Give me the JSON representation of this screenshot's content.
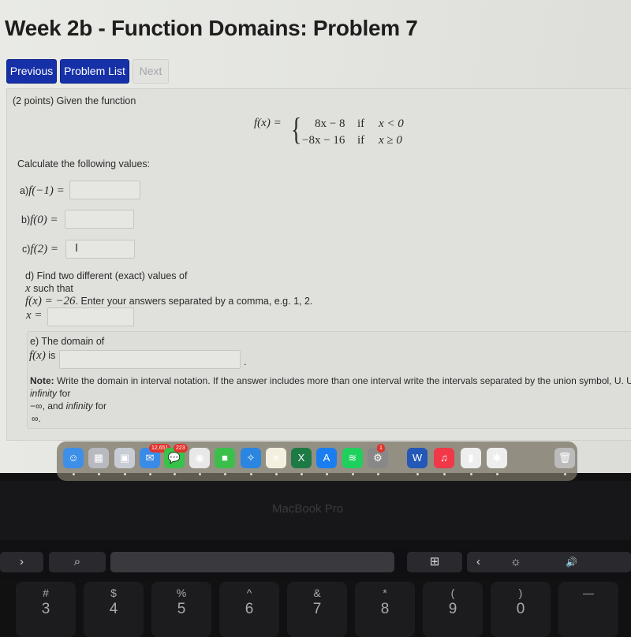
{
  "page": {
    "title": "Week 2b - Function Domains: Problem 7",
    "nav": {
      "previous": "Previous",
      "problem_list": "Problem List",
      "next": "Next"
    }
  },
  "problem": {
    "intro": "(2 points) Given the function",
    "function_lhs": "f(x) =",
    "cases": [
      {
        "expr": "8x − 8",
        "cond_word": "if",
        "cond": "x < 0"
      },
      {
        "expr": "−8x − 16",
        "cond_word": "if",
        "cond": "x ≥ 0"
      }
    ],
    "calc_prompt": "Calculate the following values:",
    "parts": {
      "a": {
        "prefix": "a)",
        "label": "f(−1) =",
        "value": ""
      },
      "b": {
        "prefix": "b)",
        "label": "f(0) =",
        "value": ""
      },
      "c": {
        "prefix": "c)",
        "label": "f(2) =",
        "value": ""
      },
      "d": {
        "line1": "d) Find two different (exact) values of",
        "line2_var": "x",
        "line2": " such that",
        "line3_math": "f(x) = −26",
        "line3": ". Enter your answers separated by a comma, e.g. 1, 2.",
        "label": "x =",
        "value": ""
      },
      "e": {
        "line1": "e) The domain of",
        "label_math": "f(x)",
        "label": " is",
        "value": "",
        "trailing": ".",
        "note_bold": "Note:",
        "note": " Write the domain in interval notation. If the answer includes more than one interval write the intervals separated by the union symbol, U. Use -",
        "note_it1": "infinity",
        "note_for1": " for",
        "neg_inf": "−∞",
        "and": ", and ",
        "note_it2": "infinity",
        "note_for2": " for",
        "pos_inf": "∞."
      }
    }
  },
  "dock": {
    "apps": [
      {
        "name": "finder",
        "glyph": "☺",
        "color": "#3d8fe8"
      },
      {
        "name": "launchpad",
        "glyph": "▦",
        "color": "#b9b9c0"
      },
      {
        "name": "preview",
        "glyph": "▣",
        "color": "#c8ccd4"
      },
      {
        "name": "mail",
        "glyph": "✉",
        "color": "#3a8be6",
        "badge": "12,651"
      },
      {
        "name": "messages",
        "glyph": "💬",
        "color": "#37c24a",
        "badge": "223"
      },
      {
        "name": "chrome",
        "glyph": "◉",
        "color": "#e8e8e8"
      },
      {
        "name": "facetime",
        "glyph": "■",
        "color": "#3ac04a"
      },
      {
        "name": "safari",
        "glyph": "✧",
        "color": "#2a86e0"
      },
      {
        "name": "notes",
        "glyph": "≡",
        "color": "#f3f0e0"
      },
      {
        "name": "excel",
        "glyph": "X",
        "color": "#1e7a44"
      },
      {
        "name": "app-store",
        "glyph": "A",
        "color": "#1a7ef0"
      },
      {
        "name": "spotify",
        "glyph": "≋",
        "color": "#1ed05c"
      },
      {
        "name": "system-preferences",
        "glyph": "⚙",
        "color": "#888",
        "badge": "1"
      },
      {
        "name": "word",
        "glyph": "W",
        "color": "#2358b8"
      },
      {
        "name": "music",
        "glyph": "♫",
        "color": "#f03848"
      },
      {
        "name": "numbers",
        "glyph": "▮",
        "color": "#eee"
      },
      {
        "name": "slack",
        "glyph": "✱",
        "color": "#eee"
      },
      {
        "name": "trash",
        "glyph": "🗑",
        "color": "#bbb"
      }
    ]
  },
  "laptop": {
    "brand": "MacBook Pro",
    "touchbar": {
      "search": "⌕",
      "chevron_right": "›",
      "new_tab": "⊞",
      "collapse": "‹",
      "brightness": "☼",
      "volume": "🔊"
    },
    "keys": [
      {
        "top": "#",
        "bottom": "3"
      },
      {
        "top": "$",
        "bottom": "4"
      },
      {
        "top": "%",
        "bottom": "5"
      },
      {
        "top": "^",
        "bottom": "6"
      },
      {
        "top": "&",
        "bottom": "7"
      },
      {
        "top": "*",
        "bottom": "8"
      },
      {
        "top": "(",
        "bottom": "9"
      },
      {
        "top": ")",
        "bottom": "0"
      },
      {
        "top": "—",
        "bottom": ""
      }
    ]
  }
}
